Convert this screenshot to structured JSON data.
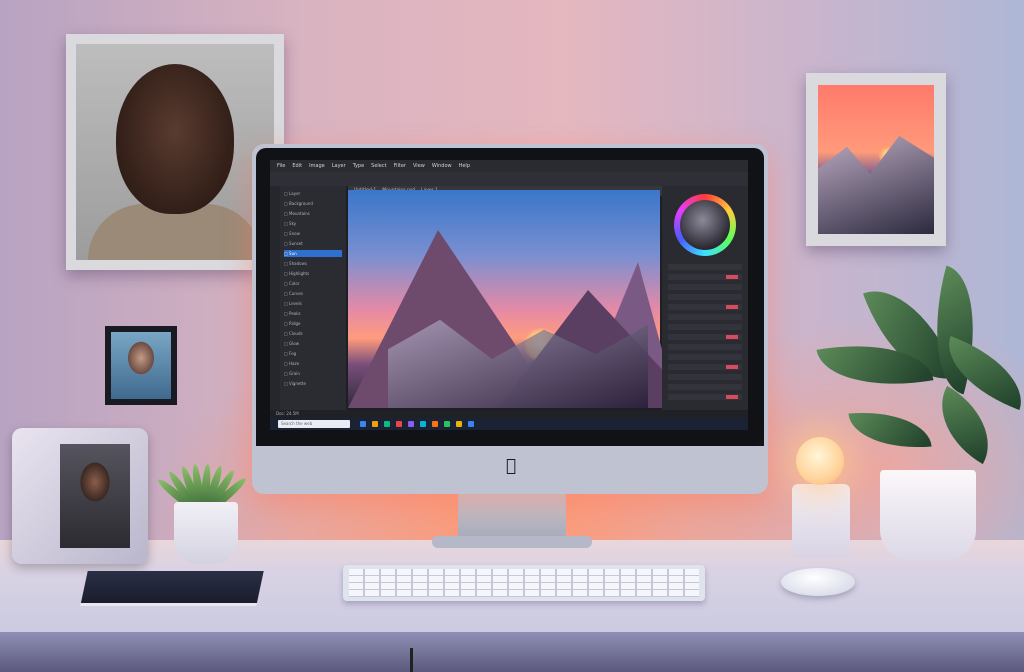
{
  "scene": {
    "description_tags": [
      "desk-setup",
      "monitor",
      "photo-editor",
      "plants",
      "lamp",
      "framed-portraits"
    ],
    "colors": {
      "wall_warm": "#e5b7bf",
      "wall_cool": "#aeb7d6",
      "glow": "#ff9b7d",
      "editor_dark": "#1e1f24",
      "selection_blue": "#2f6fd0"
    }
  },
  "editor": {
    "menu_items": [
      "File",
      "Edit",
      "Image",
      "Layer",
      "Type",
      "Select",
      "Filter",
      "View",
      "Window",
      "Help"
    ],
    "tabs": [
      "Untitled-1",
      "Mountains.psd",
      "Layer 1"
    ],
    "layers": [
      "Layer",
      "Background",
      "Mountains",
      "Sky",
      "Snow",
      "Sunset",
      "Sun",
      "Shadows",
      "Highlights",
      "Color",
      "Curves",
      "Levels",
      "Peaks",
      "Ridge",
      "Clouds",
      "Glow",
      "Fog",
      "Haze",
      "Grain",
      "Vignette"
    ],
    "right_panel_rows": 14,
    "status_text": "Doc: 24.5M",
    "taskbar_search": "Search the web"
  },
  "hardware": {
    "apple_logo": ""
  }
}
